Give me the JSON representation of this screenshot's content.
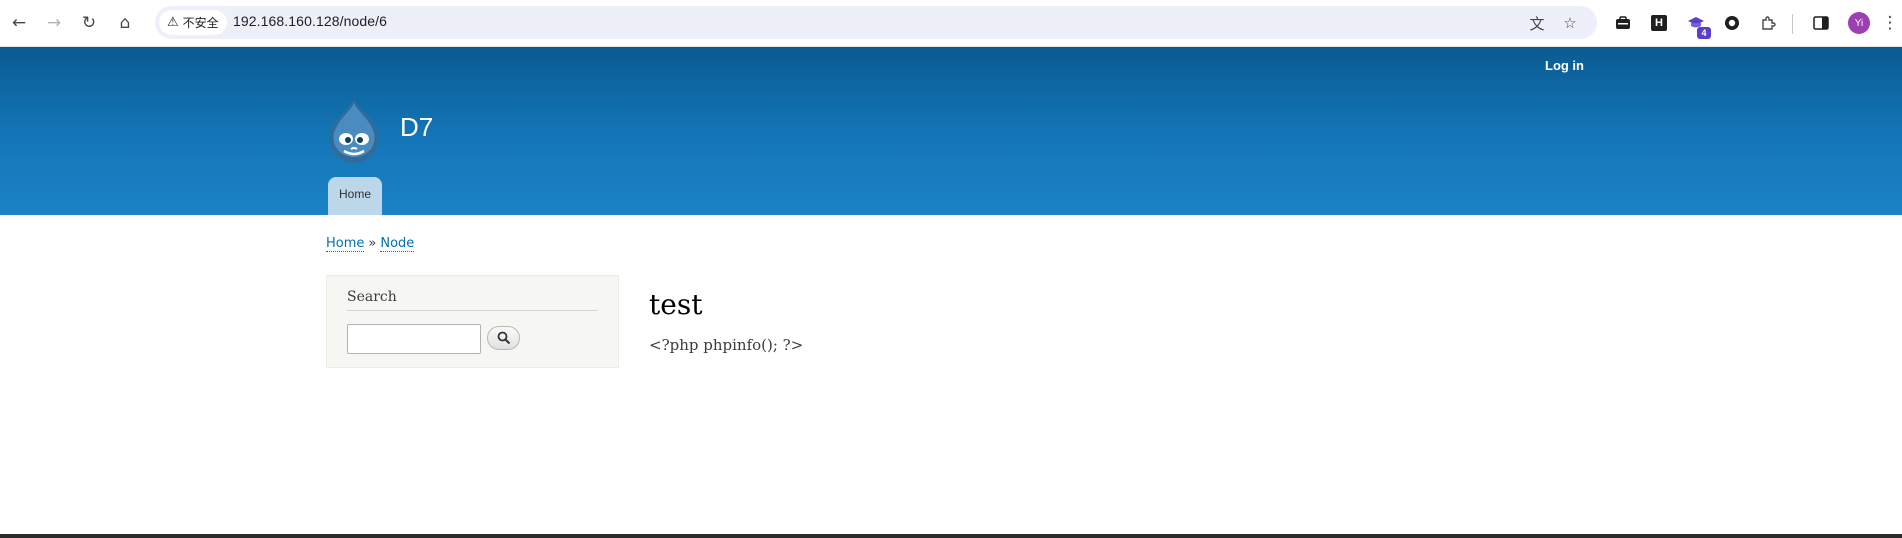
{
  "browser": {
    "back_icon": "←",
    "forward_icon": "→",
    "reload_icon": "↻",
    "home_icon": "⌂",
    "security_label": "不安全",
    "warning_icon": "⚠",
    "url": "192.168.160.128/node/6",
    "translate_icon": "文",
    "bookmark_icon": "☆",
    "extension_h_label": "H",
    "extension_badge": "4",
    "profile_initials": "Yi",
    "menu_icon": "⋮"
  },
  "header": {
    "login_label": "Log in",
    "site_name": "D7",
    "main_menu": [
      {
        "label": "Home"
      }
    ]
  },
  "breadcrumb": {
    "items": [
      "Home",
      "Node"
    ],
    "separator": "»"
  },
  "sidebar": {
    "search": {
      "title": "Search",
      "value": "",
      "placeholder": ""
    }
  },
  "node": {
    "title": "test",
    "body": "<?php phpinfo(); ?>"
  },
  "colors": {
    "header_top": "#0a5b91",
    "header_bottom": "#1b83c6",
    "link": "#0071b3",
    "tab_background": "#bcd6ea"
  }
}
